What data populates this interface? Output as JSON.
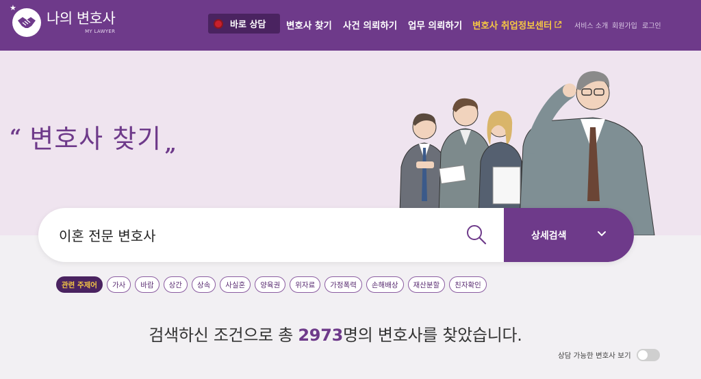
{
  "header": {
    "logo_name": "나의 변호사",
    "logo_sub": "MY LAWYER",
    "consult_label": "바로 상담",
    "nav": [
      "변호사 찾기",
      "사건 의뢰하기",
      "업무 의뢰하기"
    ],
    "job_center": "변호사 취업정보센터",
    "utility": [
      "서비스 소개",
      "회원가입",
      "로그인"
    ]
  },
  "hero": {
    "quote_open": "“",
    "title": "변호사 찾기",
    "quote_close": "”"
  },
  "search": {
    "value": "이혼 전문 변호사",
    "detail_label": "상세검색"
  },
  "tags": {
    "active": "관련 주제어",
    "items": [
      "가사",
      "바람",
      "상간",
      "상속",
      "사실혼",
      "양육권",
      "위자료",
      "가정폭력",
      "손해배상",
      "재산분할",
      "친자확인"
    ]
  },
  "result": {
    "prefix": "검색하신 조건으로 총 ",
    "count": "2973",
    "suffix": "명의 변호사를 찾았습니다."
  },
  "toggle": {
    "label": "상담 가능한 변호사 보기",
    "on": false
  },
  "colors": {
    "brand": "#6e3a8a",
    "brand_dark": "#4a2360",
    "accent": "#f4c544",
    "hero_bg": "#efe4ef"
  }
}
